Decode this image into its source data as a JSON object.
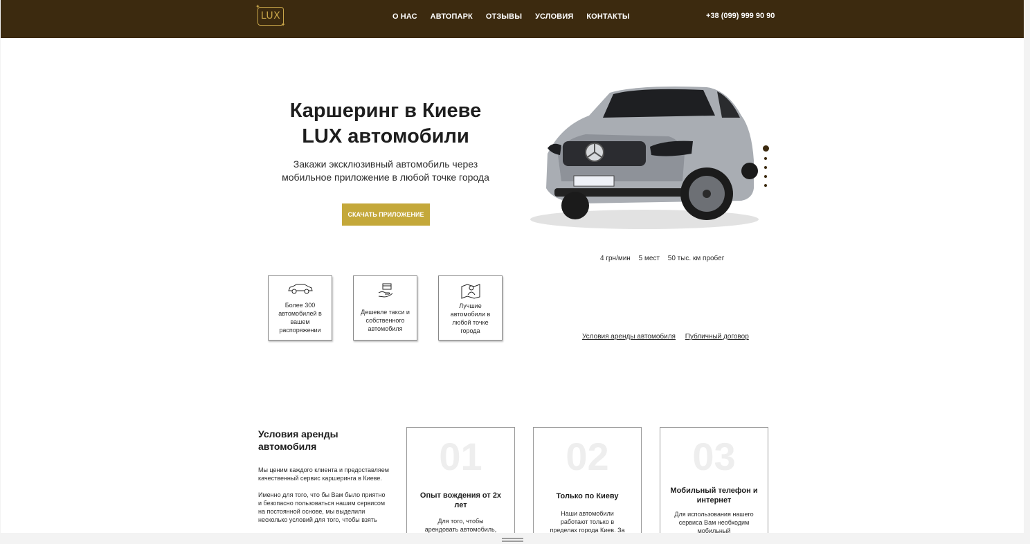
{
  "header": {
    "logo_text": "LUX",
    "nav": [
      "О НАС",
      "АВТОПАРК",
      "ОТЗЫВЫ",
      "УСЛОВИЯ",
      "КОНТАКТЫ"
    ],
    "phone": "+38 (099) 999 90 90"
  },
  "hero": {
    "title_line1": "Каршеринг в Киеве",
    "title_line2": "LUX автомобили",
    "subtitle_line1": "Закажи эксклюзивный автомобиль через",
    "subtitle_line2": "мобильное приложение в любой точке города",
    "button": "СКАЧАТЬ ПРИЛОЖЕНИЕ"
  },
  "car_specs": [
    "4 грн/мин",
    "5 мест",
    "50 тыс. км пробег"
  ],
  "features": [
    {
      "icon": "car-icon",
      "text": "Более 300 автомобилей в вашем распоряжении"
    },
    {
      "icon": "hand-card-icon",
      "text": "Дешевле такси и собственного автомобиля"
    },
    {
      "icon": "map-person-icon",
      "text": "Лучшие автомобили в любой точке города"
    }
  ],
  "links": [
    "Условия аренды автомобиля",
    "Публичный договор"
  ],
  "conditions": {
    "title": "Условия аренды автомобиля",
    "para1": "Мы ценим каждого клиента и предоставляем качественный сервис каршеринга в Киеве.",
    "para2": "Именно для того, что бы Вам было приятно и безопасно пользоваться нашим сервисом на постоянной основе, мы выделили несколько условий для того, чтобы взять",
    "cards": [
      {
        "num": "01",
        "title": "Опыт вождения от 2х лет",
        "text": "Для того, чтобы арендовать автомобиль,"
      },
      {
        "num": "02",
        "title": "Только по Киеву",
        "text": "Наши автомобили работают только в пределах города Киев. За"
      },
      {
        "num": "03",
        "title": "Мобильный телефон и интернет",
        "text": "Для использования нашего сервиса Вам необходим мобильный"
      }
    ]
  },
  "colors": {
    "header_bg": "#3c2a0f",
    "accent": "#c4a83a",
    "logo_gold": "#c9a64a"
  }
}
